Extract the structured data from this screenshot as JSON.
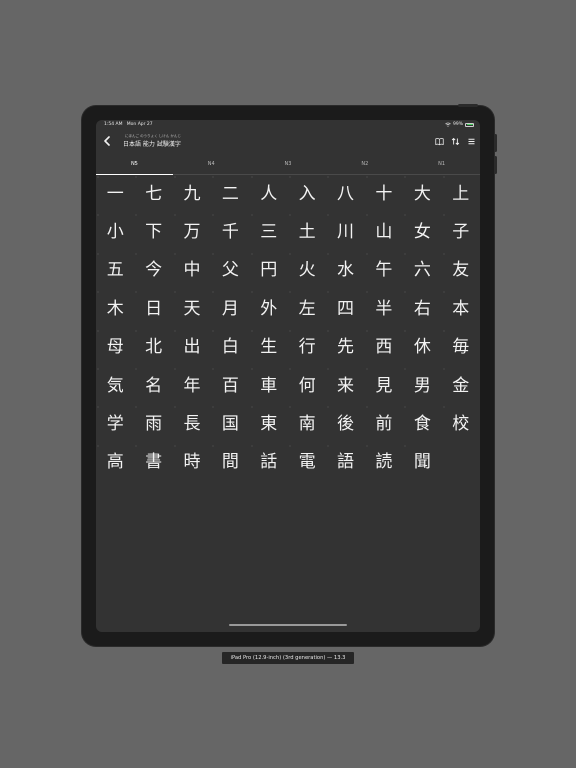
{
  "status_bar": {
    "time": "1:54 AM",
    "date": "Mon Apr 27",
    "battery": "99%"
  },
  "nav": {
    "subtitle": "にほんご のうりょく しけん かんじ",
    "title": "日本語 能力 試験漢字",
    "back_icon": "chevron-left-icon",
    "book_icon": "book-icon",
    "sort_icon": "sort-icon",
    "menu_icon": "list-icon"
  },
  "tabs": [
    {
      "label": "N5",
      "active": true
    },
    {
      "label": "N4",
      "active": false
    },
    {
      "label": "N3",
      "active": false
    },
    {
      "label": "N2",
      "active": false
    },
    {
      "label": "N1",
      "active": false
    }
  ],
  "kanji": [
    "一",
    "七",
    "九",
    "二",
    "人",
    "入",
    "八",
    "十",
    "大",
    "上",
    "小",
    "下",
    "万",
    "千",
    "三",
    "土",
    "川",
    "山",
    "女",
    "子",
    "五",
    "今",
    "中",
    "父",
    "円",
    "火",
    "水",
    "午",
    "六",
    "友",
    "木",
    "日",
    "天",
    "月",
    "外",
    "左",
    "四",
    "半",
    "右",
    "本",
    "母",
    "北",
    "出",
    "白",
    "生",
    "行",
    "先",
    "西",
    "休",
    "毎",
    "気",
    "名",
    "年",
    "百",
    "車",
    "何",
    "来",
    "見",
    "男",
    "金",
    "学",
    "雨",
    "長",
    "国",
    "東",
    "南",
    "後",
    "前",
    "食",
    "校",
    "高",
    "書",
    "時",
    "間",
    "話",
    "電",
    "語",
    "読",
    "聞"
  ],
  "device_label": "iPad Pro (12.9-inch) (3rd generation) — 13.3",
  "colors": {
    "background": "#666666",
    "screen": "#333333",
    "text": "#f3f3f3",
    "battery": "#4cd964"
  }
}
